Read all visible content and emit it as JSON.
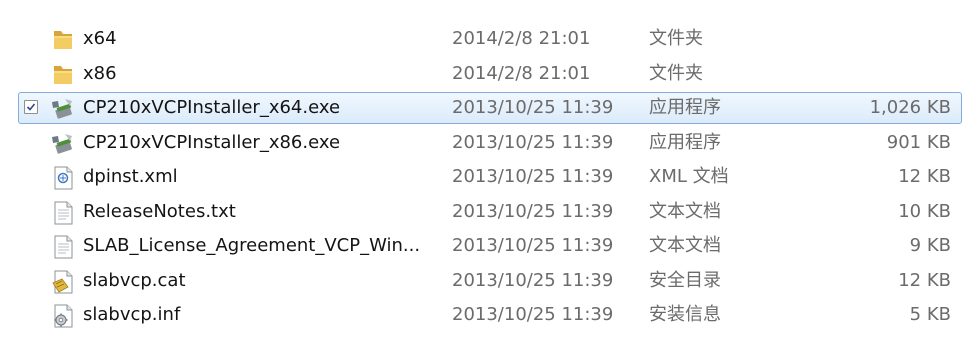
{
  "files": [
    {
      "name": "x64",
      "date": "2014/2/8 21:01",
      "type": "文件夹",
      "size": "",
      "icon": "folder-icon"
    },
    {
      "name": "x86",
      "date": "2014/2/8 21:01",
      "type": "文件夹",
      "size": "",
      "icon": "folder-icon"
    },
    {
      "name": "CP210xVCPInstaller_x64.exe",
      "date": "2013/10/25 11:39",
      "type": "应用程序",
      "size": "1,026 KB",
      "icon": "installer-icon",
      "selected": true,
      "checked": true
    },
    {
      "name": "CP210xVCPInstaller_x86.exe",
      "date": "2013/10/25 11:39",
      "type": "应用程序",
      "size": "901 KB",
      "icon": "installer-icon"
    },
    {
      "name": "dpinst.xml",
      "date": "2013/10/25 11:39",
      "type": "XML 文档",
      "size": "12 KB",
      "icon": "xml-file-icon"
    },
    {
      "name": "ReleaseNotes.txt",
      "date": "2013/10/25 11:39",
      "type": "文本文档",
      "size": "10 KB",
      "icon": "text-file-icon"
    },
    {
      "name": "SLAB_License_Agreement_VCP_Win...",
      "date": "2013/10/25 11:39",
      "type": "文本文档",
      "size": "9 KB",
      "icon": "text-file-icon"
    },
    {
      "name": "slabvcp.cat",
      "date": "2013/10/25 11:39",
      "type": "安全目录",
      "size": "12 KB",
      "icon": "security-catalog-icon"
    },
    {
      "name": "slabvcp.inf",
      "date": "2013/10/25 11:39",
      "type": "安装信息",
      "size": "5 KB",
      "icon": "setup-info-icon"
    }
  ],
  "colors": {
    "selection_border": "#84acdd",
    "selection_fill": "#dbebfb",
    "folder": "#e8b94a"
  }
}
